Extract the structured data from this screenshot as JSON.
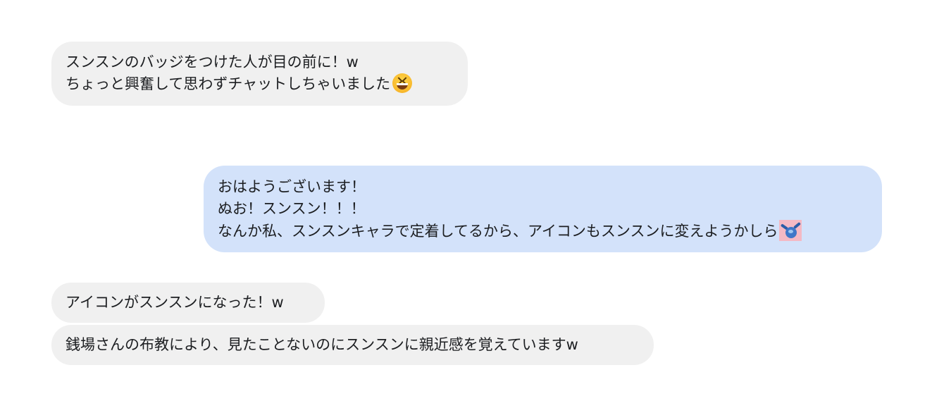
{
  "conversation": {
    "messages": [
      {
        "side": "incoming",
        "lines": [
          "スンスンのバッジをつけた人が目の前に！w",
          "ちょっと興奮して思わずチャットしちゃいました"
        ],
        "trailing_icon": "grinning-squinting-face-emoji"
      },
      {
        "side": "outgoing",
        "lines": [
          "おはようございます！",
          "ぬお！スンスン！！！",
          "なんか私、スンスンキャラで定着してるから、アイコンもスンスンに変えようかしら"
        ],
        "trailing_icon": "sunsun-sticker-icon"
      },
      {
        "side": "incoming",
        "lines": [
          "アイコンがスンスンになった！w"
        ]
      },
      {
        "side": "incoming",
        "lines": [
          "銭場さんの布教により、見たことないのにスンスンに親近感を覚えていますw"
        ]
      }
    ],
    "colors": {
      "incoming_bubble": "#f0f0f0",
      "outgoing_bubble": "#d3e2fa",
      "text": "#1c1e21"
    }
  }
}
